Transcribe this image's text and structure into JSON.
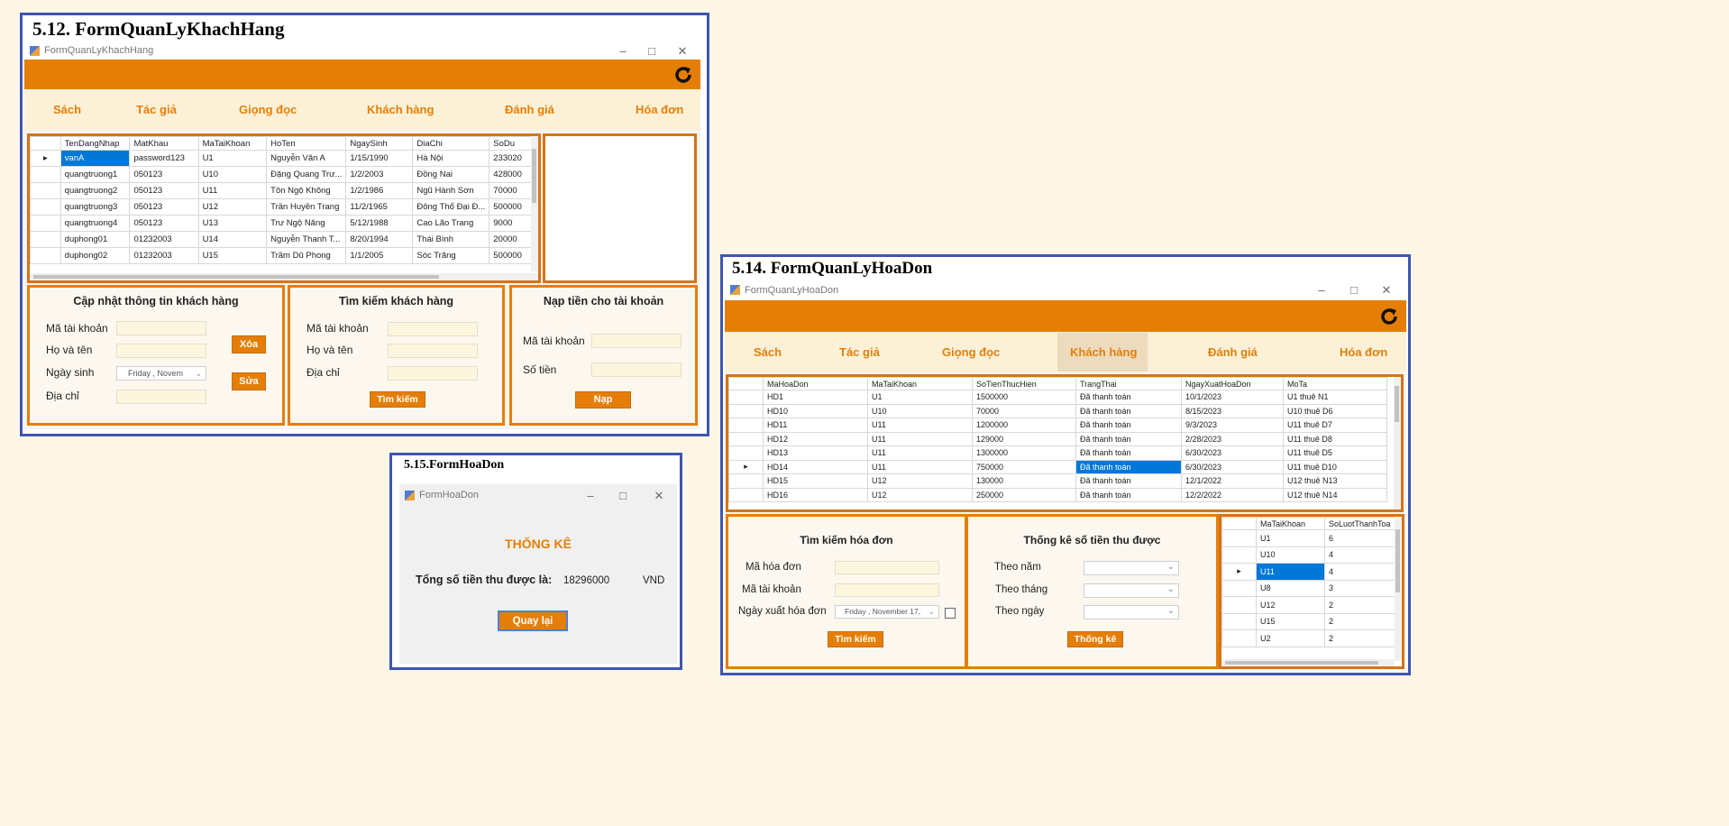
{
  "kh": {
    "heading": "5.12. FormQuanLyKhachHang",
    "window_title": "FormQuanLyKhachHang",
    "nav": [
      "Sách",
      "Tác giả",
      "Giọng đọc",
      "Khách hàng",
      "Đánh giá",
      "Hóa đơn"
    ],
    "columns": [
      "TenDangNhap",
      "MatKhau",
      "MaTaiKhoan",
      "HoTen",
      "NgaySinh",
      "DiaChi",
      "SoDu"
    ],
    "rows": [
      [
        "vanA",
        "password123",
        "U1",
        "Nguyễn Văn A",
        "1/15/1990",
        "Hà Nội",
        "233020"
      ],
      [
        "quangtruong1",
        "050123",
        "U10",
        "Đặng Quang Trư...",
        "1/2/2003",
        "Đồng Nai",
        "428000"
      ],
      [
        "quangtruong2",
        "050123",
        "U11",
        "Tôn Ngộ Không",
        "1/2/1986",
        "Ngũ Hành Sơn",
        "70000"
      ],
      [
        "quangtruong3",
        "050123",
        "U12",
        "Trần Huyền Trang",
        "11/2/1965",
        "Đông Thổ Đại Đ...",
        "500000"
      ],
      [
        "quangtruong4",
        "050123",
        "U13",
        "Trư Ngộ Năng",
        "5/12/1988",
        "Cao Lão Trang",
        "9000"
      ],
      [
        "duphong01",
        "01232003",
        "U14",
        "Nguyễn Thanh T...",
        "8/20/1994",
        "Thái Bình",
        "20000"
      ],
      [
        "duphong02",
        "01232003",
        "U15",
        "Trầm Dũ Phong",
        "1/1/2005",
        "Sóc Trăng",
        "500000"
      ]
    ],
    "update": {
      "title": "Cập nhật thông tin khách hàng",
      "lbl_account": "Mã tài khoản",
      "lbl_name": "Họ và tên",
      "lbl_dob": "Ngày sinh",
      "lbl_address": "Địa chỉ",
      "dob_value": "Friday   ,  Novem",
      "delete": "Xóa",
      "edit": "Sửa"
    },
    "search": {
      "title": "Tìm kiếm khách hàng",
      "lbl_account": "Mã tài khoản",
      "lbl_name": "Họ và tên",
      "lbl_address": "Địa chỉ",
      "button": "Tìm kiếm"
    },
    "topup": {
      "title": "Nạp tiền cho tài khoản",
      "lbl_account": "Mã tài khoản",
      "lbl_amount": "Số tiền",
      "button": "Nạp"
    }
  },
  "hdon": {
    "heading": "5.15.FormHoaDon",
    "window_title": "FormHoaDon",
    "title": "THỐNG KÊ",
    "total_label": "Tổng số tiền thu được là:",
    "total_value": "18296000",
    "unit": "VND",
    "back_button": "Quay lại"
  },
  "hd": {
    "heading": "5.14. FormQuanLyHoaDon",
    "window_title": "FormQuanLyHoaDon",
    "nav": [
      "Sách",
      "Tác giả",
      "Giọng đọc",
      "Khách hàng",
      "Đánh giá",
      "Hóa đơn"
    ],
    "columns": [
      "MaHoaDon",
      "MaTaiKhoan",
      "SoTienThucHien",
      "TrangThai",
      "NgayXuatHoaDon",
      "MoTa"
    ],
    "rows": [
      [
        "HD1",
        "U1",
        "1500000",
        "Đã thanh toán",
        "10/1/2023",
        "U1 thuê N1"
      ],
      [
        "HD10",
        "U10",
        "70000",
        "Đã thanh toán",
        "8/15/2023",
        "U10 thuê D6"
      ],
      [
        "HD11",
        "U11",
        "1200000",
        "Đã thanh toán",
        "9/3/2023",
        "U11 thuê D7"
      ],
      [
        "HD12",
        "U11",
        "129000",
        "Đã thanh toán",
        "2/28/2023",
        "U11 thuê D8"
      ],
      [
        "HD13",
        "U11",
        "1300000",
        "Đã thanh toán",
        "6/30/2023",
        "U11 thuê D5"
      ],
      [
        "HD14",
        "U11",
        "750000",
        "Đã thanh toán",
        "6/30/2023",
        "U11 thuê D10"
      ],
      [
        "HD15",
        "U12",
        "130000",
        "Đã thanh toán",
        "12/1/2022",
        "U12 thuê N13"
      ],
      [
        "HD16",
        "U12",
        "250000",
        "Đã thanh toán",
        "12/2/2022",
        "U12 thuê N14"
      ]
    ],
    "search": {
      "title": "Tìm kiếm hóa đơn",
      "lbl_invoice": "Mã hóa đơn",
      "lbl_account": "Mã tài khoản",
      "lbl_date": "Ngày xuất hóa đơn",
      "date_value": "Friday    ,  November 17,",
      "button": "Tìm kiếm"
    },
    "stats": {
      "title": "Thống kê số tiền thu được",
      "lbl_year": "Theo năm",
      "lbl_month": "Theo tháng",
      "lbl_day": "Theo ngày",
      "button": "Thống kê"
    },
    "side_columns": [
      "MaTaiKhoan",
      "SoLuotThanhToa"
    ],
    "side_rows": [
      [
        "U1",
        "6"
      ],
      [
        "U10",
        "4"
      ],
      [
        "U11",
        "4"
      ],
      [
        "U8",
        "3"
      ],
      [
        "U12",
        "2"
      ],
      [
        "U15",
        "2"
      ],
      [
        "U2",
        "2"
      ]
    ]
  },
  "colors": {
    "accent": "#e57e07",
    "nav_bg": "#fcf1d7",
    "border_blue": "#3e55b1",
    "selection": "#0078d7",
    "page_bg": "#fdf6e6"
  }
}
